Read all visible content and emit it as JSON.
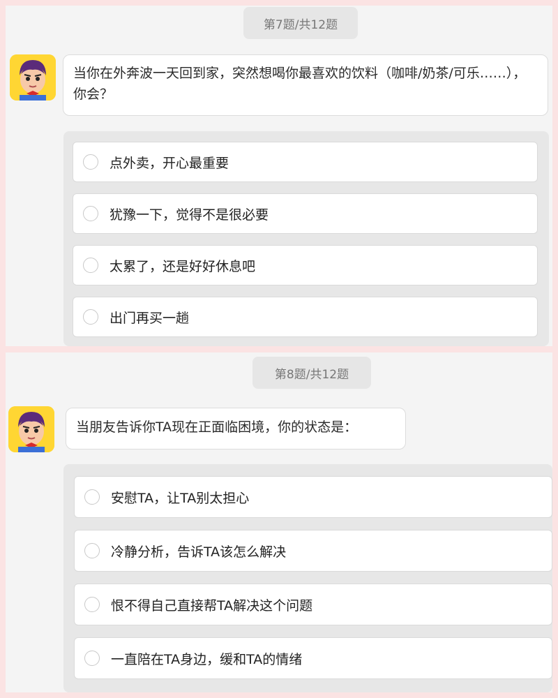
{
  "questions": [
    {
      "counter": "第7题/共12题",
      "question_text": "当你在外奔波一天回到家，突然想喝你最喜欢的饮料（咖啡/奶茶/可乐……），你会？",
      "options": [
        "点外卖，开心最重要",
        "犹豫一下，觉得不是很必要",
        "太累了，还是好好休息吧",
        "出门再买一趟"
      ]
    },
    {
      "counter": "第8题/共12题",
      "question_text": "当朋友告诉你TA现在正面临困境，你的状态是：",
      "options": [
        "安慰TA，让TA别太担心",
        "冷静分析，告诉TA该怎么解决",
        "恨不得自己直接帮TA解决这个问题",
        "一直陪在TA身边，缓和TA的情绪"
      ]
    }
  ],
  "colors": {
    "page_background": "#fbe3e3",
    "panel_background": "#f4f4f4",
    "options_background": "#e7e7e7",
    "avatar_background": "#ffd633"
  },
  "icons": {
    "avatar": "cartoon-boy-avatar-icon",
    "option_marker": "radio-circle-icon"
  }
}
